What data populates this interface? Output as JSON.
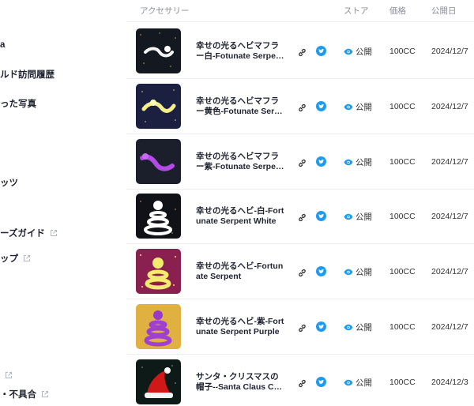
{
  "sidebar": {
    "items": [
      {
        "label": "a",
        "external": false
      },
      {
        "label": "ルド訪問履歴",
        "external": false
      },
      {
        "label": "った写真",
        "external": false
      },
      {
        "label": "ッツ",
        "external": false
      },
      {
        "label": "ーズガイド",
        "external": true
      },
      {
        "label": "ップ",
        "external": true
      },
      {
        "label": "",
        "external": true
      },
      {
        "label": "・不具合",
        "external": true
      }
    ]
  },
  "table": {
    "headers": {
      "accessory": "アクセサリー",
      "store": "ストア",
      "price": "価格",
      "published": "公開日"
    },
    "rows": [
      {
        "title1": "幸せの光るヘビマフラ",
        "title2": "ー白-Fotunate Serpen...",
        "status": "公開",
        "price": "100CC",
        "date": "2024/12/7",
        "thumb_theme": "white-scarf"
      },
      {
        "title1": "幸せの光るヘビマフラ",
        "title2": "ー黄色-Fotunate Serp...",
        "status": "公開",
        "price": "100CC",
        "date": "2024/12/7",
        "thumb_theme": "yellow-scarf"
      },
      {
        "title1": "幸せの光るヘビマフラ",
        "title2": "ー紫-Fotunate Serpen...",
        "status": "公開",
        "price": "100CC",
        "date": "2024/12/7",
        "thumb_theme": "purple-scarf"
      },
      {
        "title1": "幸せの光るヘビ-白-Fort",
        "title2": "unate Serpent White",
        "status": "公開",
        "price": "100CC",
        "date": "2024/12/7",
        "thumb_theme": "white-serpent"
      },
      {
        "title1": "幸せの光るヘビ-Fortun",
        "title2": "ate Serpent",
        "status": "公開",
        "price": "100CC",
        "date": "2024/12/7",
        "thumb_theme": "yellow-serpent"
      },
      {
        "title1": "幸せの光るヘビ-紫-Fort",
        "title2": "unate Serpent Purple",
        "status": "公開",
        "price": "100CC",
        "date": "2024/12/7",
        "thumb_theme": "purple-serpent"
      },
      {
        "title1": "サンタ・クリスマスの",
        "title2": "帽子--Santa Claus Ca...",
        "status": "公開",
        "price": "100CC",
        "date": "2024/12/3",
        "thumb_theme": "santa-hat"
      }
    ]
  },
  "colors": {
    "twitter": "#1d9bf0",
    "eye": "#1d9bf0",
    "text_dark": "#1f2230",
    "header_gray": "#8a8e99"
  }
}
